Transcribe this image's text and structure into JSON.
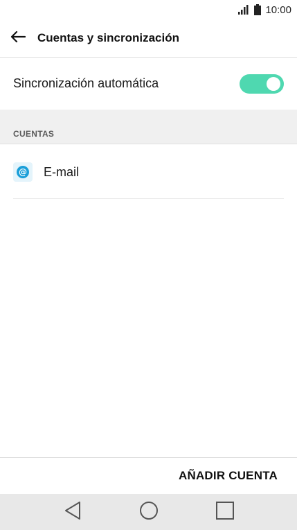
{
  "status_bar": {
    "time": "10:00",
    "icons": [
      "signal-icon",
      "battery-icon"
    ]
  },
  "app_bar": {
    "title": "Cuentas y sincronización",
    "back_icon": "arrow-left-icon"
  },
  "sync": {
    "label": "Sincronización automática",
    "enabled": true,
    "toggle_color": "#4fd8b0"
  },
  "accounts_section": {
    "header": "CUENTAS",
    "items": [
      {
        "label": "E-mail",
        "icon": "at-sign-icon",
        "icon_color": "#1a9fd9"
      }
    ]
  },
  "actions": {
    "add_account": "AÑADIR CUENTA"
  },
  "nav_bar": {
    "buttons": [
      "back-triangle-icon",
      "home-circle-icon",
      "recents-square-icon"
    ]
  }
}
